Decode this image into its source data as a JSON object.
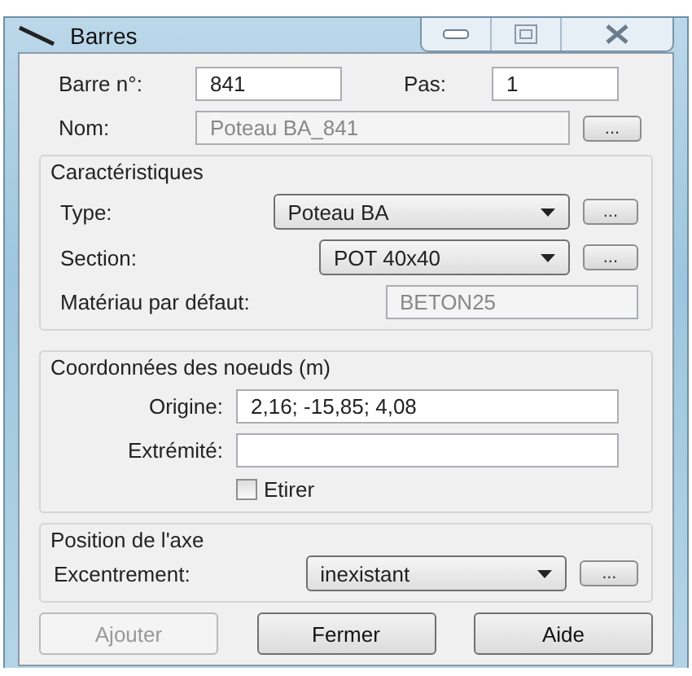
{
  "window": {
    "title": "Barres"
  },
  "bar_number": {
    "label": "Barre n°:",
    "value": "841"
  },
  "step": {
    "label": "Pas:",
    "value": "1"
  },
  "name": {
    "label": "Nom:",
    "value": "Poteau BA_841",
    "disabled": true,
    "more": "..."
  },
  "characteristics": {
    "title": "Caractéristiques",
    "type": {
      "label": "Type:",
      "value": "Poteau BA",
      "more": "..."
    },
    "section": {
      "label": "Section:",
      "value": "POT 40x40",
      "more": "..."
    },
    "material": {
      "label": "Matériau par défaut:",
      "value": "BETON25",
      "disabled": true
    }
  },
  "node_coordinates": {
    "title": "Coordonnées des noeuds (m)",
    "origin": {
      "label": "Origine:",
      "value": "2,16; -15,85; 4,08"
    },
    "end": {
      "label": "Extrémité:"
    },
    "stretch": {
      "label": "Etirer",
      "checked": false
    }
  },
  "axis_position": {
    "title": "Position de l'axe",
    "eccentricity": {
      "label": "Excentrement:",
      "value": "inexistant",
      "more": "..."
    }
  },
  "buttons": [
    {
      "label": "Ajouter",
      "disabled": true
    },
    {
      "label": "Fermer",
      "disabled": false
    },
    {
      "label": "Aide",
      "disabled": false
    }
  ]
}
